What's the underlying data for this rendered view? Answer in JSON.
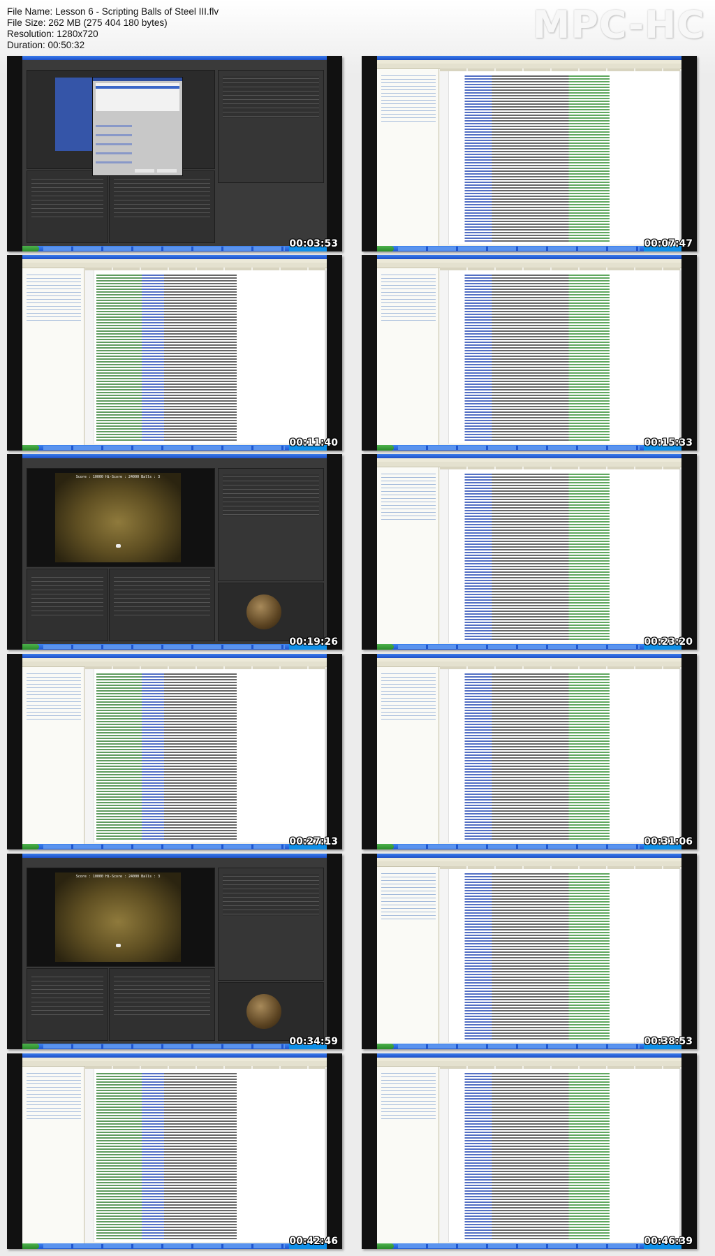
{
  "header": {
    "file_name": "File Name: Lesson 6 - Scripting Balls of Steel III.flv",
    "file_size": "File Size: 262 MB (275 404 180 bytes)",
    "resolution": "Resolution: 1280x720",
    "duration": "Duration: 00:50:32"
  },
  "logo": "MPC-HC",
  "thumbnails": [
    {
      "timestamp": "00:03:53",
      "kind": "unity-dialog"
    },
    {
      "timestamp": "00:07:47",
      "kind": "ide"
    },
    {
      "timestamp": "00:11:40",
      "kind": "ide"
    },
    {
      "timestamp": "00:15:33",
      "kind": "ide"
    },
    {
      "timestamp": "00:19:26",
      "kind": "unity-game",
      "hud": "Score : 10000  Hi-Score : 24000  Balls : 3"
    },
    {
      "timestamp": "00:23:20",
      "kind": "ide"
    },
    {
      "timestamp": "00:27:13",
      "kind": "ide"
    },
    {
      "timestamp": "00:31:06",
      "kind": "ide"
    },
    {
      "timestamp": "00:34:59",
      "kind": "unity-game",
      "hud": "Score : 10000  Hi-Score : 24000  Balls : 3"
    },
    {
      "timestamp": "00:38:53",
      "kind": "ide"
    },
    {
      "timestamp": "00:42:46",
      "kind": "ide"
    },
    {
      "timestamp": "00:46:39",
      "kind": "ide"
    }
  ]
}
